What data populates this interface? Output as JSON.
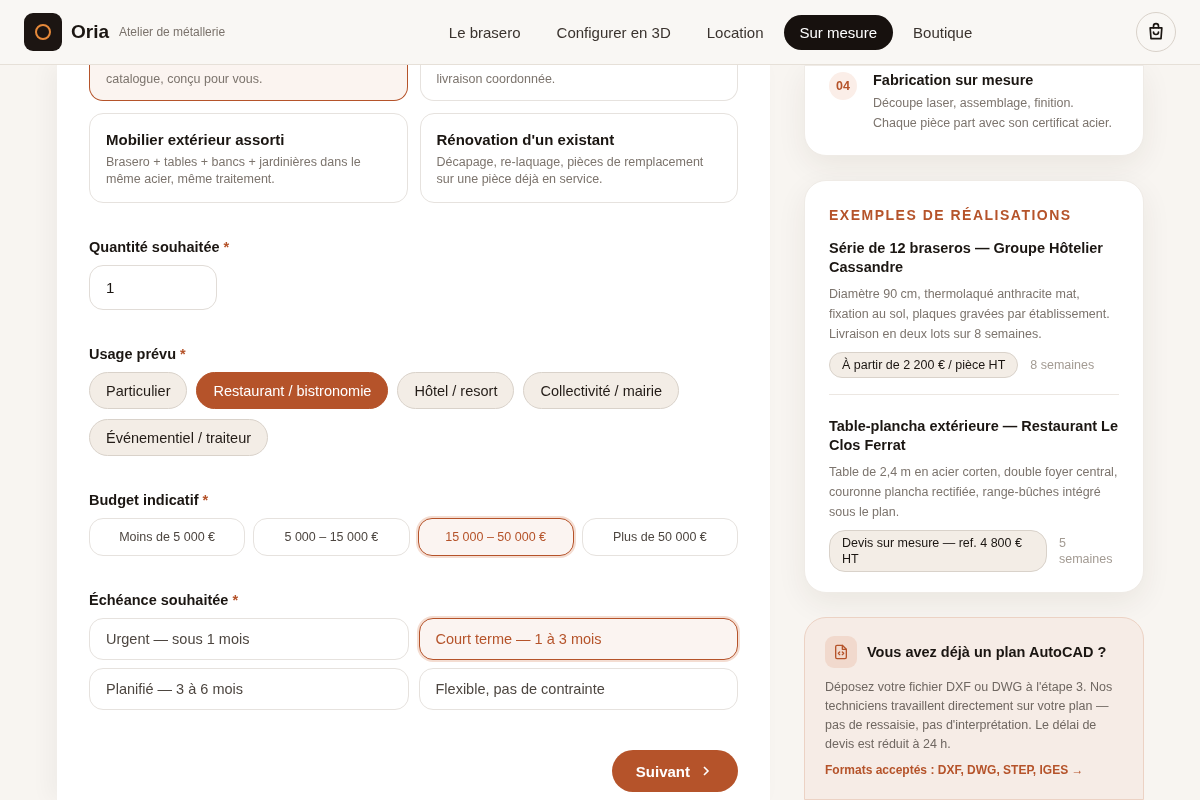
{
  "header": {
    "brand": "Oria",
    "tagline": "Atelier de métallerie",
    "nav": [
      {
        "label": "Le brasero",
        "selected": false
      },
      {
        "label": "Configurer en 3D",
        "selected": false
      },
      {
        "label": "Location",
        "selected": false
      },
      {
        "label": "Sur mesure",
        "selected": true
      },
      {
        "label": "Boutique",
        "selected": false
      }
    ]
  },
  "project_types": [
    {
      "description": "catalogue, conçu pour vous.",
      "selected": true
    },
    {
      "description": "livraison coordonnée.",
      "selected": false
    },
    {
      "title": "Mobilier extérieur assorti",
      "description": "Brasero + tables + bancs + jardinières dans le même acier, même traitement.",
      "selected": false
    },
    {
      "title": "Rénovation d'un existant",
      "description": "Décapage, re-laquage, pièces de remplacement sur une pièce déjà en service.",
      "selected": false
    }
  ],
  "quantity": {
    "label": "Quantité souhaitée",
    "required_mark": "*",
    "value": "1"
  },
  "usage": {
    "label": "Usage prévu",
    "required_mark": "*",
    "options": [
      {
        "label": "Particulier",
        "selected": false
      },
      {
        "label": "Restaurant / bistronomie",
        "selected": true
      },
      {
        "label": "Hôtel / resort",
        "selected": false
      },
      {
        "label": "Collectivité / mairie",
        "selected": false
      },
      {
        "label": "Événementiel / traiteur",
        "selected": false
      }
    ]
  },
  "budget": {
    "label": "Budget indicatif",
    "required_mark": "*",
    "options": [
      {
        "label": "Moins de 5 000 €",
        "selected": false
      },
      {
        "label": "5 000 – 15 000 €",
        "selected": false
      },
      {
        "label": "15 000 – 50 000 €",
        "selected": true
      },
      {
        "label": "Plus de 50 000 €",
        "selected": false
      }
    ]
  },
  "deadline": {
    "label": "Échéance souhaitée",
    "required_mark": "*",
    "options": [
      {
        "label": "Urgent — sous 1 mois",
        "selected": false
      },
      {
        "label": "Court terme — 1 à 3 mois",
        "selected": true
      },
      {
        "label": "Planifié — 3 à 6 mois",
        "selected": false
      },
      {
        "label": "Flexible, pas de contrainte",
        "selected": false
      }
    ]
  },
  "next_button": {
    "label": "Suivant"
  },
  "step": {
    "number": "04",
    "title": "Fabrication sur mesure",
    "lines": [
      "Découpe laser, assemblage, finition.",
      "Chaque pièce part avec son certificat acier."
    ]
  },
  "examples": {
    "heading": "EXEMPLES DE RÉALISATIONS",
    "items": [
      {
        "title": "Série de 12 braseros — Groupe Hôtelier Cassandre",
        "description": "Diamètre 90 cm, thermolaqué anthracite mat, fixation au sol, plaques gravées par établissement. Livraison en deux lots sur 8 semaines.",
        "price": "À partir de 2 200 € / pièce HT",
        "duration": "8 semaines"
      },
      {
        "title": "Table-plancha extérieure — Restaurant Le Clos Ferrat",
        "description": "Table de 2,4 m en acier corten, double foyer central, couronne plancha rectifiée, range-bûches intégré sous le plan.",
        "price": "Devis sur mesure — ref. 4 800 € HT",
        "duration": "5 semaines"
      }
    ]
  },
  "autocad": {
    "title": "Vous avez déjà un plan AutoCAD ?",
    "text": "Déposez votre fichier DXF ou DWG à l'étape 3. Nos techniciens travaillent directement sur votre plan — pas de ressaisie, pas d'interprétation. Le délai de devis est réduit à 24 h.",
    "link": "Formats acceptés : DXF, DWG, STEP, IGES →"
  }
}
